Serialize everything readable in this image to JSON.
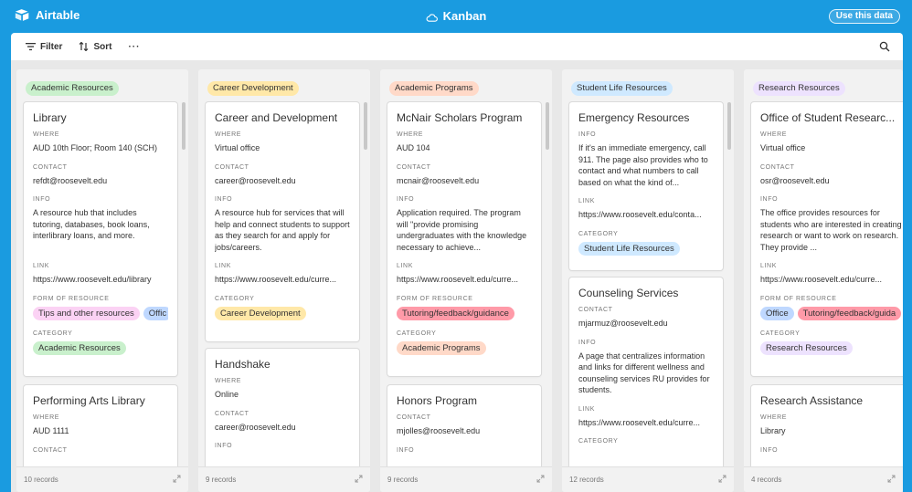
{
  "app": {
    "name": "Airtable",
    "view_title": "Kanban",
    "use_data_label": "Use this data"
  },
  "toolbar": {
    "filter_label": "Filter",
    "sort_label": "Sort",
    "more_label": "···"
  },
  "colors": {
    "academic_resources": "#c9f0cc",
    "career_development": "#ffe8a8",
    "academic_programs": "#ffd9c8",
    "student_life_resources": "#cfe9ff",
    "research_resources": "#ede2fe",
    "tips": "#fbd2f4",
    "office": "#bfd8ff",
    "tutoring": "#ff9aa8"
  },
  "columns": [
    {
      "label": "Academic Resources",
      "records": "10 records",
      "cards": [
        {
          "title": "Library",
          "where_label": "WHERE",
          "where": "AUD 10th Floor; Room 140 (SCH)",
          "contact_label": "CONTACT",
          "contact": "refdt@roosevelt.edu",
          "info_label": "INFO",
          "info": "A resource hub that includes tutoring, databases, book loans, interlibrary loans, and more.",
          "link_label": "LINK",
          "link": "https://www.roosevelt.edu/library",
          "form_label": "FORM OF RESOURCE",
          "form_1": "Tips and other resources",
          "form_2": "Offic",
          "category_label": "CATEGORY",
          "category": "Academic Resources"
        },
        {
          "title": "Performing Arts Library",
          "where_label": "WHERE",
          "where": "AUD 1111",
          "contact_label": "CONTACT"
        }
      ]
    },
    {
      "label": "Career Development",
      "records": "9 records",
      "cards": [
        {
          "title": "Career and Development",
          "where_label": "WHERE",
          "where": "Virtual office",
          "contact_label": "CONTACT",
          "contact": "career@roosevelt.edu",
          "info_label": "INFO",
          "info": "A resource hub for services that will help and connect students to support as they search for and apply for jobs/careers.",
          "link_label": "LINK",
          "link": "https://www.roosevelt.edu/curre...",
          "category_label": "CATEGORY",
          "category": "Career Development"
        },
        {
          "title": "Handshake",
          "where_label": "WHERE",
          "where": "Online",
          "contact_label": "CONTACT",
          "contact": "career@roosevelt.edu",
          "info_label": "INFO"
        }
      ]
    },
    {
      "label": "Academic Programs",
      "records": "9 records",
      "cards": [
        {
          "title": "McNair Scholars Program",
          "where_label": "WHERE",
          "where": "AUD 104",
          "contact_label": "CONTACT",
          "contact": "mcnair@roosevelt.edu",
          "info_label": "INFO",
          "info": "Application required. The program will \"provide promising undergraduates with the knowledge necessary to achieve...",
          "link_label": "LINK",
          "link": "https://www.roosevelt.edu/curre...",
          "form_label": "FORM OF RESOURCE",
          "form_1": "Tutoring/feedback/guidance",
          "category_label": "CATEGORY",
          "category": "Academic Programs"
        },
        {
          "title": "Honors Program",
          "contact_label": "CONTACT",
          "contact": "mjolles@roosevelt.edu",
          "info_label": "INFO"
        }
      ]
    },
    {
      "label": "Student Life Resources",
      "records": "12 records",
      "cards": [
        {
          "title": "Emergency Resources",
          "info_label": "INFO",
          "info": "If it's an immediate emergency, call 911. The page also provides who to contact and what numbers to call based on what the kind of...",
          "link_label": "LINK",
          "link": "https://www.roosevelt.edu/conta...",
          "category_label": "CATEGORY",
          "category": "Student Life Resources"
        },
        {
          "title": "Counseling Services",
          "contact_label": "CONTACT",
          "contact": "mjarmuz@roosevelt.edu",
          "info_label": "INFO",
          "info": "A page that centralizes information and links for different wellness and counseling services RU provides for students.",
          "link_label": "LINK",
          "link": "https://www.roosevelt.edu/curre...",
          "category_label": "CATEGORY"
        }
      ]
    },
    {
      "label": "Research Resources",
      "records": "4 records",
      "cards": [
        {
          "title": "Office of Student Researc...",
          "where_label": "WHERE",
          "where": "Virtual office",
          "contact_label": "CONTACT",
          "contact": "osr@roosevelt.edu",
          "info_label": "INFO",
          "info": "The office provides resources for students who are interested in creating research or want to work on research. They provide ...",
          "link_label": "LINK",
          "link": "https://www.roosevelt.edu/curre...",
          "form_label": "FORM OF RESOURCE",
          "form_1": "Office",
          "form_2": "Tutoring/feedback/guida",
          "category_label": "CATEGORY",
          "category": "Research Resources"
        },
        {
          "title": "Research Assistance",
          "where_label": "WHERE",
          "where": "Library",
          "info_label": "INFO"
        }
      ]
    }
  ]
}
